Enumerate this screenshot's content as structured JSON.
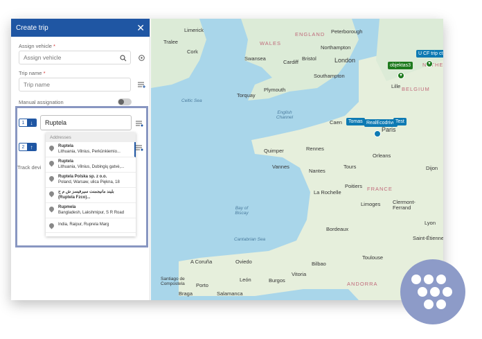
{
  "header": {
    "title": "Create trip",
    "close_glyph": "✕"
  },
  "form": {
    "assign_vehicle": {
      "label": "Assign vehicle",
      "required": "*",
      "placeholder": "Assign vehicle"
    },
    "trip_name": {
      "label": "Trip name",
      "required": "*",
      "placeholder": "Trip name"
    },
    "manual_assignation": {
      "label": "Manual assignation",
      "enabled": false
    },
    "track_device_label": "Track devi"
  },
  "route": {
    "steps": [
      {
        "number": "1",
        "direction": "down"
      },
      {
        "number": "2",
        "direction": "up"
      }
    ],
    "search_value": "Ruptela",
    "dropdown_header": "Addresses",
    "suggestions": [
      {
        "title": "Ruptela",
        "subtitle": "Lithuania, Vilnius, Perkūnkiemio..."
      },
      {
        "title": "Ruptela",
        "subtitle": "Lithuania, Vilnius, Dubingių gatvė,..."
      },
      {
        "title": "Ruptela Polska sp. z o.o.",
        "subtitle": "Poland, Warsaw, ulica Piękna, 18"
      },
      {
        "title": "بلیند مانیجمنت سیرفیسز ش م ح",
        "subtitle": "(Ruptela Fzco)..."
      },
      {
        "title": "Rupmela",
        "subtitle": "Bangladesh, Lakshmipur, S R Road"
      },
      {
        "title": "",
        "subtitle": "India, Raipur, Ruprela Marg"
      }
    ]
  },
  "map": {
    "places": [
      "Limerick",
      "Tralee",
      "Cork",
      "Swansea",
      "Cardiff",
      "Bristol",
      "London",
      "Northampton",
      "Peterborough",
      "Southampton",
      "Plymouth",
      "Torquay",
      "Caen",
      "Rennes",
      "Quimper",
      "Vannes",
      "Nantes",
      "Orleans",
      "Tours",
      "Dijon",
      "Limoges",
      "Poitiers",
      "La Rochelle",
      "Clermont-Ferrand",
      "Bordeaux",
      "Toulouse",
      "Bilbao",
      "Oviedo",
      "A Coruña",
      "Santiago de Compostela",
      "León",
      "Burgos",
      "Vitoria",
      "Braga",
      "Porto",
      "Salamanca",
      "Lille",
      "Paris",
      "Lyon",
      "Saint-Étienne"
    ],
    "countries": [
      "ENGLAND",
      "WALES",
      "FRANCE",
      "BELGIUM",
      "NETHERLA",
      "ANDORRA"
    ],
    "seas": [
      "Celtic Sea",
      "English Channel",
      "Bay of Biscay",
      "Cantabrian Sea"
    ],
    "vehicle_tags": [
      "Tomas",
      "RealEcodrive",
      "Test",
      "objektas3",
      "U CF trip ct"
    ]
  }
}
